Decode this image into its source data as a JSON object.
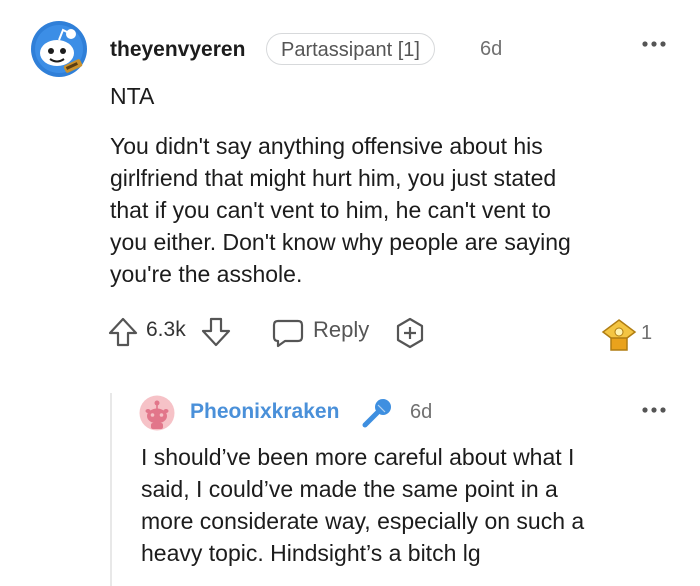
{
  "comment": {
    "username": "theyenvyeren",
    "flair": "Partassipant [1]",
    "time": "6d",
    "verdict": "NTA",
    "body_lines": [
      "You didn't say anything offensive about his",
      "girlfriend that might hurt him, you just stated",
      "that if you can't vent to him, he can't vent to",
      "you either. Don't know why people are saying",
      "you're the asshole."
    ],
    "score": "6.3k",
    "reply_label": "Reply",
    "award_count": "1"
  },
  "reply": {
    "username": "Pheonixkraken",
    "time": "6d",
    "body_lines": [
      "I should’ve been more careful about what I",
      "said, I could’ve made the same point in a",
      "more considerate way, especially on such a",
      "heavy topic. Hindsight’s a bitch lg"
    ]
  },
  "icons": {
    "avatar1": "snoo-avatar-icon",
    "avatar2": "snoo-avatar-icon",
    "upvote": "upvote-arrow-icon",
    "downvote": "downvote-arrow-icon",
    "reply": "speech-bubble-icon",
    "award": "add-award-icon",
    "award_received": "gold-award-icon",
    "more": "more-options-icon",
    "op": "microphone-icon"
  },
  "colors": {
    "op_username": "#4a90d9",
    "text": "#1c1c1c",
    "muted": "#707070"
  }
}
